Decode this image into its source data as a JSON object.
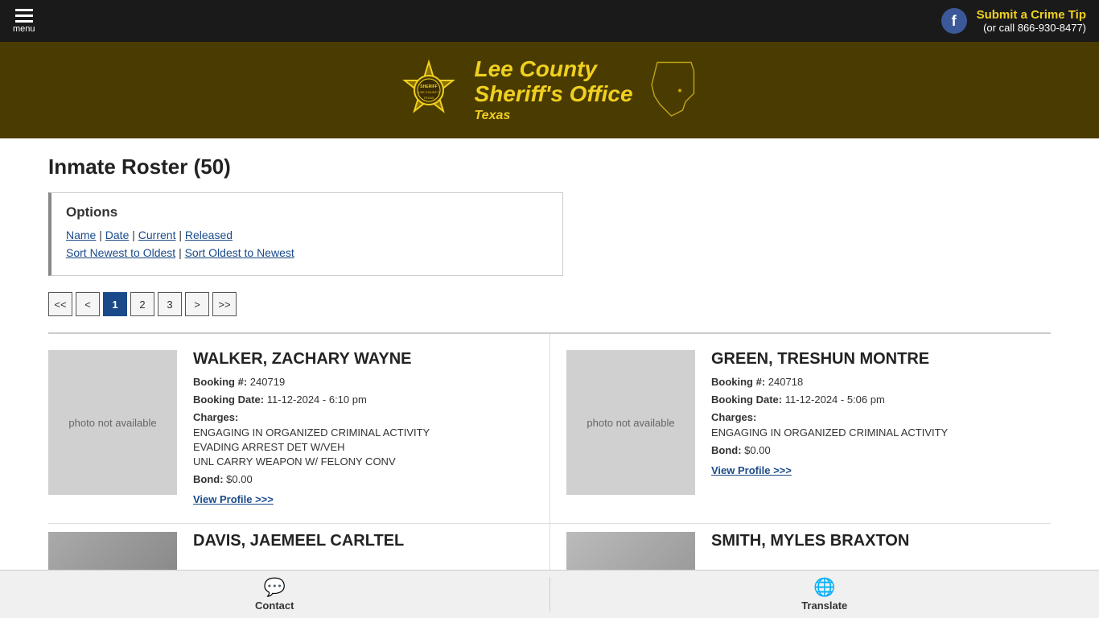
{
  "topbar": {
    "menu_label": "menu",
    "crime_tip_label": "Submit a Crime Tip",
    "crime_tip_phone": "(or call 866-930-8477)",
    "facebook_letter": "f"
  },
  "header": {
    "line1": "Lee County",
    "line2": "Sheriff's Office",
    "line3": "Texas"
  },
  "page": {
    "title": "Inmate Roster (50)"
  },
  "options": {
    "label": "Options",
    "filters": [
      "Name",
      "Date",
      "Current",
      "Released"
    ],
    "sorts": [
      "Sort Newest to Oldest",
      "Sort Oldest to Newest"
    ]
  },
  "pagination": {
    "prev_prev": "<<",
    "prev": "<",
    "pages": [
      "1",
      "2",
      "3"
    ],
    "next": ">",
    "next_next": ">>",
    "active": "1"
  },
  "inmates": [
    {
      "name": "WALKER, ZACHARY WAYNE",
      "booking_num": "240719",
      "booking_date": "11-12-2024 - 6:10 pm",
      "charges": [
        "ENGAGING IN ORGANIZED CRIMINAL ACTIVITY",
        "EVADING ARREST DET W/VEH",
        "UNL CARRY WEAPON W/ FELONY CONV"
      ],
      "bond": "$0.00",
      "view_profile": "View Profile >>>",
      "photo_text": "photo not available"
    },
    {
      "name": "GREEN, TRESHUN MONTRE",
      "booking_num": "240718",
      "booking_date": "11-12-2024 - 5:06 pm",
      "charges": [
        "ENGAGING IN ORGANIZED CRIMINAL ACTIVITY"
      ],
      "bond": "$0.00",
      "view_profile": "View Profile >>>",
      "photo_text": "photo not available"
    },
    {
      "name": "DAVIS, JAEMEEL CARLTEL",
      "booking_num": "",
      "booking_date": "",
      "charges": [],
      "bond": "",
      "view_profile": "",
      "photo_text": ""
    },
    {
      "name": "SMITH, MYLES BRAXTON",
      "booking_num": "",
      "booking_date": "",
      "charges": [],
      "bond": "",
      "view_profile": "",
      "photo_text": ""
    }
  ],
  "bottombar": {
    "contact_label": "Contact",
    "translate_label": "Translate",
    "contact_icon": "💬",
    "translate_icon": "🌐"
  },
  "labels": {
    "booking_num": "Booking #:",
    "booking_date": "Booking Date:",
    "charges": "Charges:",
    "bond": "Bond:"
  }
}
